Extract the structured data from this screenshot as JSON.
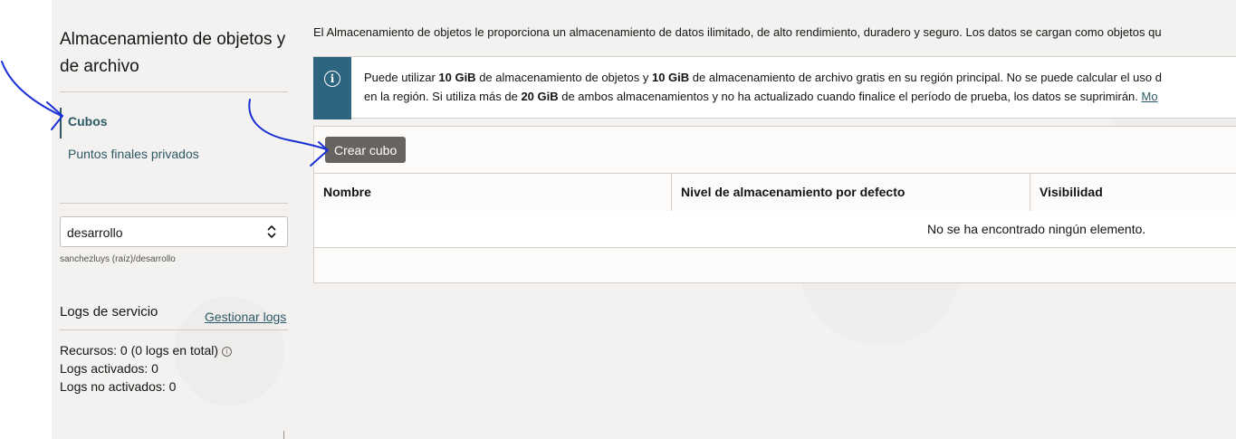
{
  "sidebar": {
    "title": "Almacenamiento de objetos y de archivo",
    "nav": [
      {
        "label": "Cubos",
        "active": true
      },
      {
        "label": "Puntos finales privados",
        "active": false
      }
    ],
    "compartment": {
      "value": "desarrollo",
      "path": "sanchezluys (raíz)/desarrollo"
    },
    "logs": {
      "title": "Logs de servicio",
      "manage_link": "Gestionar logs",
      "resources": "Recursos:  0 (0 logs en total)",
      "enabled": "Logs activados:  0",
      "disabled": "Logs no activados:  0"
    }
  },
  "main": {
    "intro": "El Almacenamiento de objetos le proporciona un almacenamiento de datos ilimitado, de alto rendimiento, duradero y seguro. Los datos se cargan como objetos qu",
    "notice": {
      "line1_a": "Puede utilizar ",
      "line1_b": "10 GiB",
      "line1_c": " de almacenamiento de objetos y ",
      "line1_d": "10 GiB",
      "line1_e": " de almacenamiento de archivo gratis en su región principal. No se puede calcular el uso d",
      "line2_a": "en la región. Si utiliza más de ",
      "line2_b": "20 GiB",
      "line2_c": " de ambos almacenamientos y no ha actualizado cuando finalice el período de prueba, los datos se suprimirán.  ",
      "line2_link": "Mo"
    },
    "create_button": "Crear cubo",
    "table": {
      "columns": [
        "Nombre",
        "Nivel de almacenamiento por defecto",
        "Visibilidad"
      ],
      "empty_message": "No se ha encontrado ningún elemento."
    }
  },
  "colors": {
    "page_bg": "#f3f2f0",
    "link": "#2c5967",
    "notice_strip": "#2d6480",
    "button_bg": "#676360",
    "annotation_ink": "#1b2fd6"
  },
  "icons": [
    "info-icon",
    "chevron-updown-icon",
    "info-small-icon"
  ]
}
